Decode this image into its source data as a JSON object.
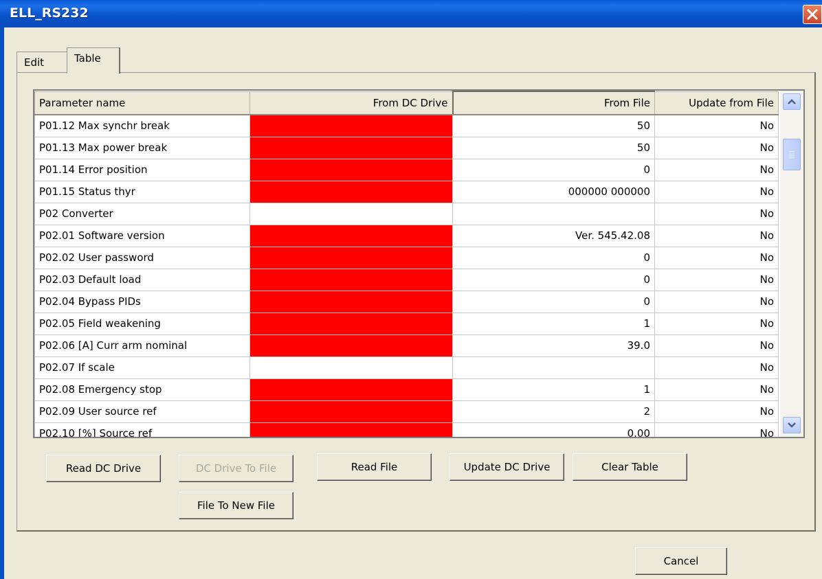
{
  "window": {
    "title": "ELL_RS232"
  },
  "tabs": [
    {
      "label": "Edit"
    },
    {
      "label": "Table"
    }
  ],
  "table": {
    "columns": [
      "Parameter name",
      "From DC Drive",
      "From File",
      "Update from File"
    ],
    "rows": [
      {
        "name": "P01.12 Max synchr break",
        "drive_value": "",
        "drive_flag": "red",
        "file_value": "50",
        "update": "No"
      },
      {
        "name": "P01.13 Max power break",
        "drive_value": "",
        "drive_flag": "red",
        "file_value": "50",
        "update": "No"
      },
      {
        "name": "P01.14 Error position",
        "drive_value": "",
        "drive_flag": "red",
        "file_value": "0",
        "update": "No"
      },
      {
        "name": "P01.15 Status thyr",
        "drive_value": "",
        "drive_flag": "red",
        "file_value": "000000 000000",
        "update": "No"
      },
      {
        "name": "P02 Converter",
        "drive_value": "",
        "drive_flag": "none",
        "file_value": "",
        "update": "No"
      },
      {
        "name": "P02.01 Software version",
        "drive_value": "",
        "drive_flag": "red",
        "file_value": "Ver. 545.42.08",
        "update": "No"
      },
      {
        "name": "P02.02 User password",
        "drive_value": "",
        "drive_flag": "red",
        "file_value": "0",
        "update": "No"
      },
      {
        "name": "P02.03 Default load",
        "drive_value": "",
        "drive_flag": "red",
        "file_value": "0",
        "update": "No"
      },
      {
        "name": "P02.04 Bypass PIDs",
        "drive_value": "",
        "drive_flag": "red",
        "file_value": "0",
        "update": "No"
      },
      {
        "name": "P02.05 Field weakening",
        "drive_value": "",
        "drive_flag": "red",
        "file_value": "1",
        "update": "No"
      },
      {
        "name": "P02.06 [A] Curr arm nominal",
        "drive_value": "",
        "drive_flag": "red",
        "file_value": "39.0",
        "update": "No"
      },
      {
        "name": "P02.07 If scale",
        "drive_value": "",
        "drive_flag": "none",
        "file_value": "",
        "update": "No"
      },
      {
        "name": "P02.08 Emergency stop",
        "drive_value": "",
        "drive_flag": "red",
        "file_value": "1",
        "update": "No"
      },
      {
        "name": "P02.09 User source ref",
        "drive_value": "",
        "drive_flag": "red",
        "file_value": "2",
        "update": "No"
      },
      {
        "name": "P02.10 [%] Source ref",
        "drive_value": "",
        "drive_flag": "red",
        "file_value": "0.00",
        "update": "No"
      }
    ]
  },
  "buttons": {
    "read_dc_drive": "Read DC Drive",
    "dc_drive_to_file": "DC Drive To File",
    "read_file": "Read File",
    "update_dc_drive": "Update DC Drive",
    "clear_table": "Clear Table",
    "file_to_new_file": "File To New File",
    "cancel": "Cancel"
  },
  "colors": {
    "titlebar": "#0A5BD6",
    "missing_value": "#FF0000",
    "dialog_bg": "#ECE9D8"
  },
  "icons": {
    "close": "close-icon",
    "scroll_up": "chevron-up-icon",
    "scroll_down": "chevron-down-icon"
  }
}
